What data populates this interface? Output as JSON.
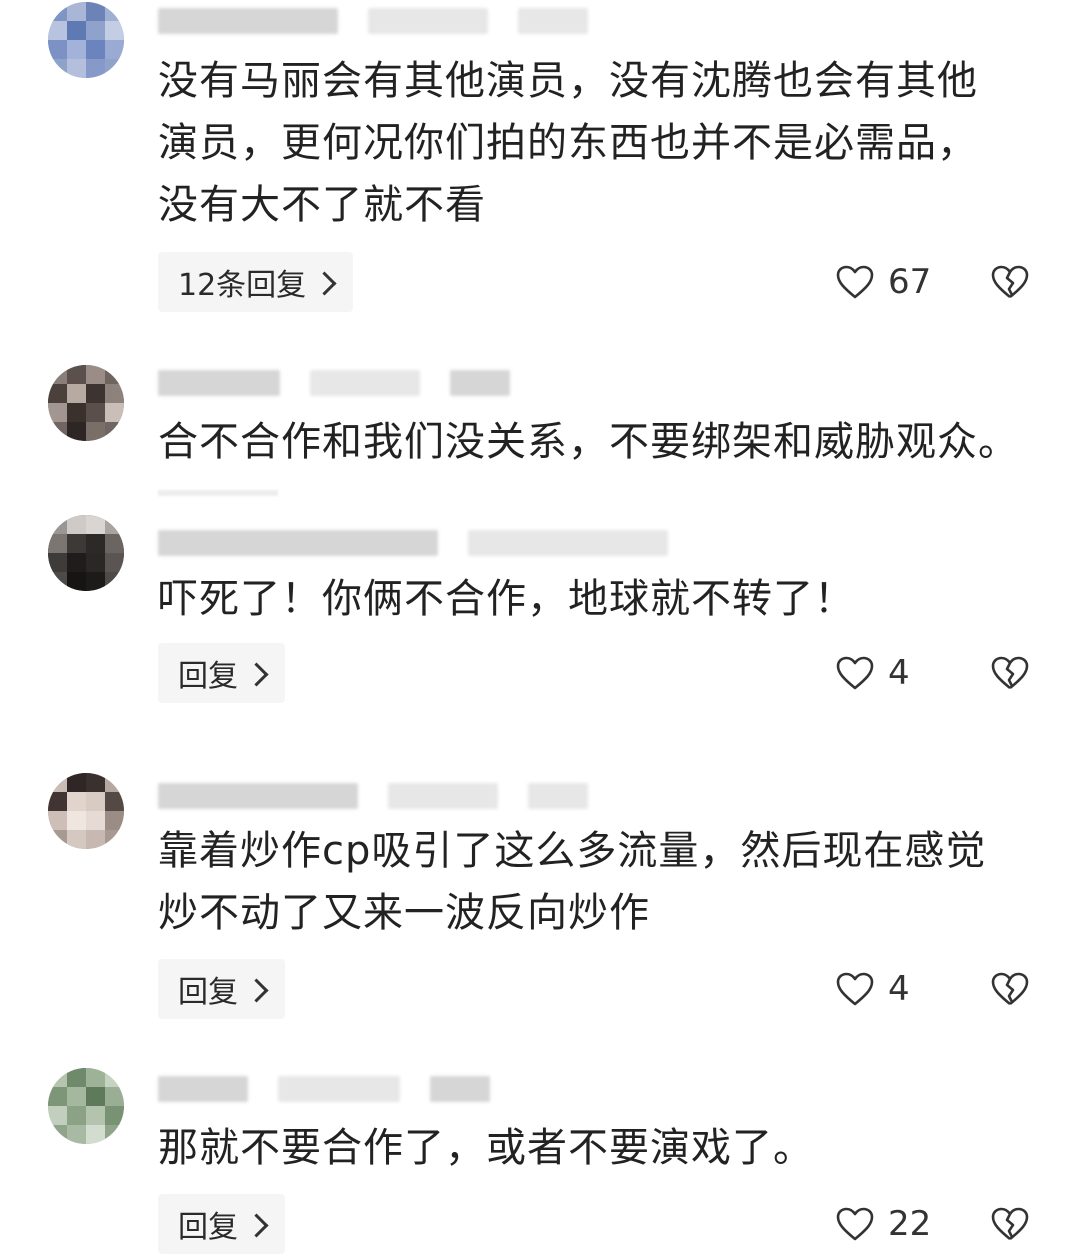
{
  "comments": [
    {
      "text": "没有马丽会有其他演员，没有沈腾也会有其他\n演员，更何况你们拍的东西也并不是必需品，\n没有大不了就不看",
      "reply_label": "12条回复",
      "likes": "67"
    },
    {
      "text": "合不合作和我们没关系，不要绑架和威胁观众。"
    },
    {
      "text": "吓死了！你俩不合作，地球就不转了！",
      "reply_label": "回复",
      "likes": "4"
    },
    {
      "text": "靠着炒作cp吸引了这么多流量，然后现在感觉\n炒不动了又来一波反向炒作",
      "reply_label": "回复",
      "likes": "4"
    },
    {
      "text": "那就不要合作了，或者不要演戏了。",
      "reply_label": "回复",
      "likes": "22"
    }
  ],
  "icons": {
    "like": "heart-outline-icon",
    "dislike": "broken-heart-icon",
    "reply_arrow": "chevron-right-icon"
  },
  "colors": {
    "text": "#222222",
    "reply_bg": "#f5f5f5",
    "icon": "#333333"
  }
}
